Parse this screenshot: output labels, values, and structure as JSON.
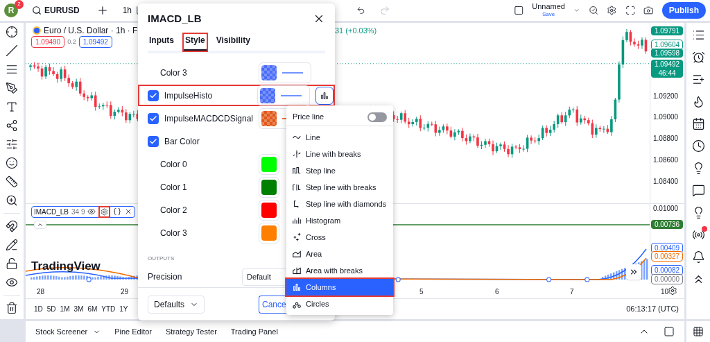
{
  "topbar": {
    "avatar": "R",
    "badge": "2",
    "symbol": "EURUSD",
    "interval": "1h",
    "layout_name": "Unnamed",
    "save": "Save",
    "publish": "Publish"
  },
  "chart": {
    "legend": "Euro / U.S. Dollar · 1h · F",
    "change": "31 (+0.03%)",
    "sell": "1.09490",
    "spread": "0.2",
    "buy": "1.09492",
    "logo": "TradingView",
    "ticks": [
      "1.09200",
      "1.09000",
      "1.08800",
      "1.08600",
      "1.08400"
    ],
    "price_labels": [
      {
        "text": "1.09791",
        "kind": "filled",
        "color": "#089981"
      },
      {
        "text": "1.09604",
        "kind": "outline",
        "color": "#089981"
      },
      {
        "text": "1.09598",
        "kind": "filled",
        "color": "#089981"
      },
      {
        "text": "1.09492",
        "sub": "46:44",
        "kind": "filled",
        "color": "#089981"
      }
    ]
  },
  "indicator": {
    "name": "IMACD_LB",
    "params": "34 9",
    "tick": "0.01000",
    "labels": [
      {
        "text": "0.00736",
        "kind": "filled",
        "color": "#2e7d32"
      },
      {
        "text": "0.00409",
        "kind": "outline",
        "color": "#2962ff"
      },
      {
        "text": "0.00327",
        "kind": "outline",
        "color": "#ef6c00"
      },
      {
        "text": "0.00082",
        "kind": "outline",
        "color": "#2962ff"
      },
      {
        "text": "0.00000",
        "kind": "outline",
        "color": "#787b86"
      }
    ]
  },
  "time_axis": [
    "28",
    "29",
    "5",
    "6",
    "7",
    "10"
  ],
  "ranges": [
    "1D",
    "5D",
    "1M",
    "3M",
    "6M",
    "YTD",
    "1Y"
  ],
  "clock": "06:13:17 (UTC)",
  "bottom_tabs": [
    "Stock Screener",
    "Pine Editor",
    "Strategy Tester",
    "Trading Panel"
  ],
  "dialog": {
    "title": "IMACD_LB",
    "tabs": [
      {
        "label": "Inputs",
        "selected": false,
        "annotated": false
      },
      {
        "label": "Style",
        "selected": true,
        "annotated": true
      },
      {
        "label": "Visibility",
        "selected": false,
        "annotated": false
      }
    ],
    "rows": [
      {
        "kind": "color",
        "label": "Color 3",
        "color": "#4a6cf7",
        "checkered": true,
        "line": {
          "color": "#7094ff"
        },
        "annotated": false
      },
      {
        "kind": "plot",
        "label": "ImpulseHisto",
        "checked": true,
        "color": "#4a6cf7",
        "checkered": true,
        "line": {
          "color": "#7094ff"
        },
        "style_button": true,
        "annotated": true
      },
      {
        "kind": "plot",
        "label": "ImpulseMACDCDSignal",
        "checked": true,
        "color": "#e0581a",
        "checkered": true,
        "line": {
          "color": "#f07040"
        },
        "style_button": false,
        "annotated": false
      },
      {
        "kind": "check",
        "label": "Bar Color",
        "checked": true,
        "annotated": false
      },
      {
        "kind": "color",
        "label": "Color 0",
        "color": "#00ff00",
        "checkered": false,
        "annotated": false
      },
      {
        "kind": "color",
        "label": "Color 1",
        "color": "#008000",
        "checkered": false,
        "annotated": false
      },
      {
        "kind": "color",
        "label": "Color 2",
        "color": "#ff0000",
        "checkered": false,
        "annotated": false
      },
      {
        "kind": "color",
        "label": "Color 3",
        "color": "#ff8000",
        "checkered": false,
        "annotated": false
      }
    ],
    "outputs_heading": "OUTPUTS",
    "precision_label": "Precision",
    "precision_value": "Default",
    "defaults": "Defaults",
    "cancel": "Cance"
  },
  "plot_menu": {
    "price_line": {
      "label": "Price line",
      "on": false
    },
    "items": [
      {
        "label": "Line",
        "selected": false
      },
      {
        "label": "Line with breaks",
        "selected": false
      },
      {
        "label": "Step line",
        "selected": false
      },
      {
        "label": "Step line with breaks",
        "selected": false
      },
      {
        "label": "Step line with diamonds",
        "selected": false
      },
      {
        "label": "Histogram",
        "selected": false
      },
      {
        "label": "Cross",
        "selected": false
      },
      {
        "label": "Area",
        "selected": false
      },
      {
        "label": "Area with breaks",
        "selected": false
      },
      {
        "label": "Columns",
        "selected": true
      },
      {
        "label": "Circles",
        "selected": false
      }
    ]
  }
}
